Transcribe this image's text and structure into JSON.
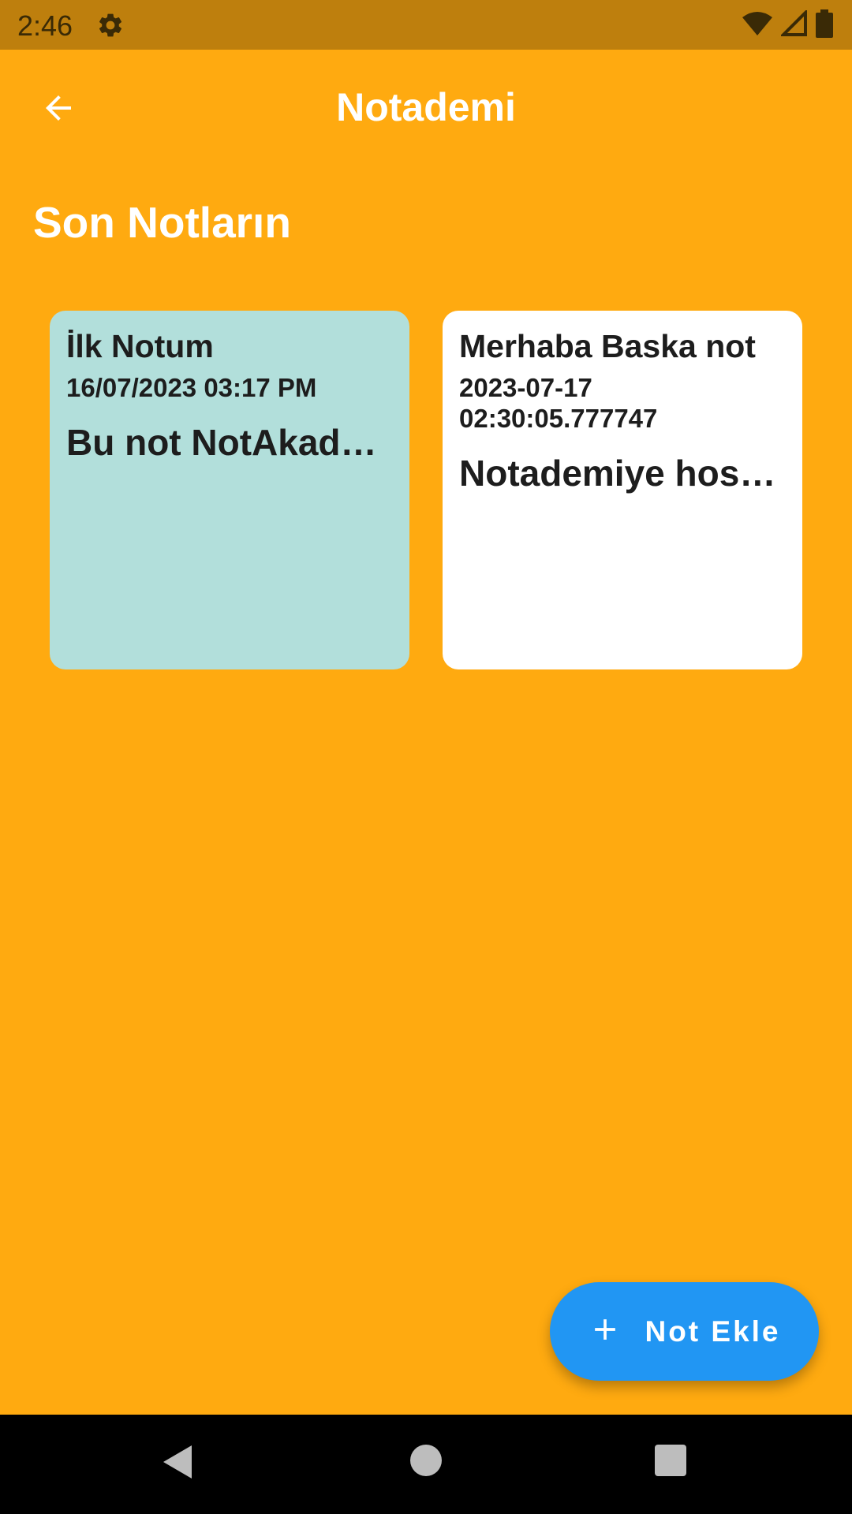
{
  "status_bar": {
    "time": "2:46",
    "icons": [
      "settings-icon",
      "wifi-icon",
      "signal-icon",
      "battery-icon"
    ]
  },
  "app_bar": {
    "title": "Notademi",
    "back_icon": "arrow-back-icon"
  },
  "section": {
    "title": "Son Notların"
  },
  "notes": [
    {
      "title": "İlk Notum",
      "date": "16/07/2023 03:17 PM",
      "body": "Bu not NotAkademi",
      "color": "#B2DFDB"
    },
    {
      "title": "Merhaba Baska not",
      "date": "2023-07-17 02:30:05.777747",
      "body": "Notademiye hosgeldin",
      "color": "#FFFFFF"
    }
  ],
  "fab": {
    "label": "Not Ekle",
    "icon": "plus-icon",
    "color": "#2196F3"
  },
  "colors": {
    "background": "#FFAA10",
    "status_bar": "#BE7F0D"
  },
  "nav_bar": {
    "icons": [
      "nav-back-icon",
      "nav-home-icon",
      "nav-recents-icon"
    ]
  }
}
